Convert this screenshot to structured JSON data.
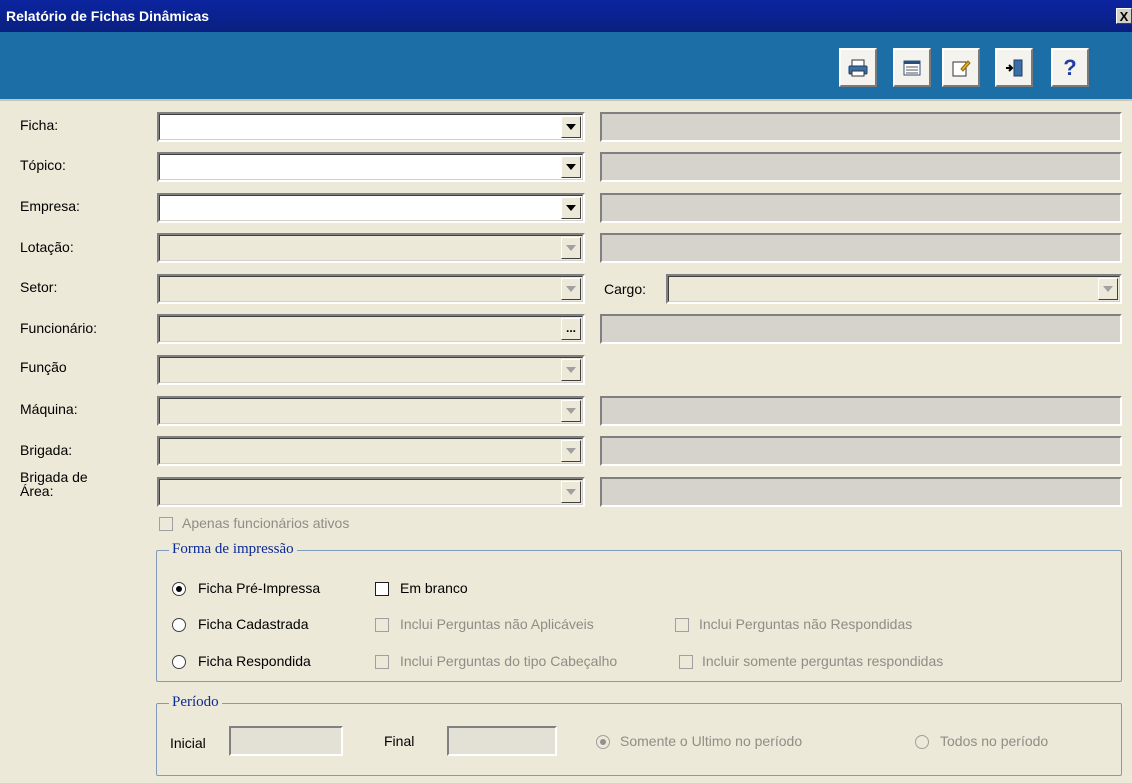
{
  "window": {
    "title": "Relatório de Fichas Dinâmicas",
    "close_glyph": "X"
  },
  "toolbar": {
    "buttons": [
      {
        "name": "print",
        "icon": "printer-icon"
      },
      {
        "name": "preview",
        "icon": "table-icon"
      },
      {
        "name": "edit",
        "icon": "edit-note-icon"
      },
      {
        "name": "exit",
        "icon": "exit-door-icon"
      },
      {
        "name": "help",
        "icon": "help-icon",
        "glyph": "?"
      }
    ]
  },
  "fields": {
    "ficha": "Ficha:",
    "topico": "Tópico:",
    "empresa": "Empresa:",
    "lotacao": "Lotação:",
    "setor": "Setor:",
    "cargo": "Cargo:",
    "funcionario": "Funcionário:",
    "funcao": "Função",
    "maquina": "Máquina:",
    "brigada": "Brigada:",
    "brigada_area_1": "Brigada de",
    "brigada_area_2": "Área:",
    "lookup_glyph": "..."
  },
  "apenas_ativos": "Apenas funcionários ativos",
  "forma": {
    "legend": "Forma de impressão",
    "pre_impressa": "Ficha Pré-Impressa",
    "cadastrada": "Ficha Cadastrada",
    "respondida": "Ficha Respondida",
    "em_branco": "Em branco",
    "nao_aplicaveis": "Inclui Perguntas não  Aplicáveis",
    "nao_respondidas": "Inclui Perguntas não Respondidas",
    "cabecalho": "Inclui Perguntas do tipo Cabeçalho",
    "somente_respondidas": "Incluir somente perguntas respondidas"
  },
  "periodo": {
    "legend": "Período",
    "inicial": "Inicial",
    "final": "Final",
    "somente_ultimo": "Somente o Ultimo no período",
    "todos": "Todos no período"
  },
  "colors": {
    "toolbar": "#1b6fa6",
    "titlebar": "#0b249f",
    "legend": "#0b2a96"
  }
}
